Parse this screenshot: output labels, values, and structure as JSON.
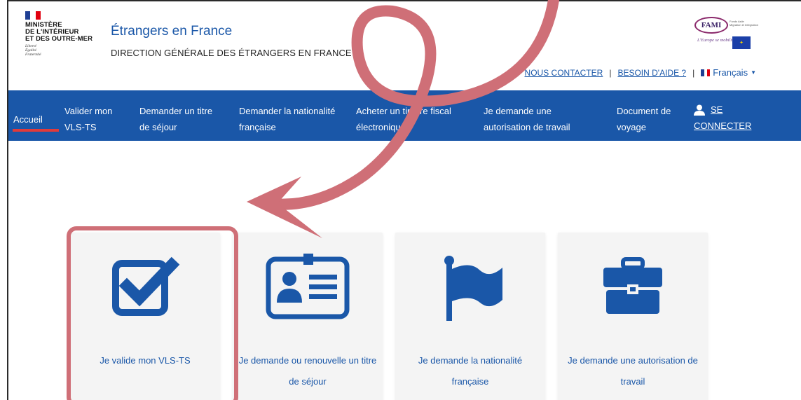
{
  "header": {
    "ministry": "MINISTÈRE\nDE L'INTÉRIEUR\nET DES OUTRE-MER",
    "motto": "Liberté\nÉgalité\nFraternité",
    "site_title": "Étrangers en France",
    "site_subtitle": "DIRECTION GÉNÉRALE DES ÉTRANGERS EN FRANCE",
    "fami": {
      "brand": "FAMI",
      "small_text": "Fonds Asile\nMigration et Intégration",
      "slogan": "L'Europe se mobilise"
    },
    "top_links": {
      "contact": "NOUS CONTACTER",
      "help": "BESOIN D'AIDE ?",
      "language": "Français",
      "separator": "|"
    }
  },
  "nav": {
    "items": [
      {
        "label": "Accueil",
        "active": true
      },
      {
        "label": "Valider mon\nVLS-TS"
      },
      {
        "label": "Demander un titre\nde séjour"
      },
      {
        "label": "Demander la nationalité\nfrançaise"
      },
      {
        "label": "Acheter un timbre fiscal\nélectronique"
      },
      {
        "label": "Je demande une\nautorisation de travail"
      },
      {
        "label": "Document de\nvoyage"
      }
    ],
    "login_line1": "SE",
    "login_line2": "CONNECTER"
  },
  "cards": [
    {
      "label": "Je valide mon VLS-TS",
      "icon": "checkbox-check-icon"
    },
    {
      "label": "Je demande ou renouvelle un titre\nde séjour",
      "icon": "id-card-icon"
    },
    {
      "label": "Je demande la nationalité\nfrançaise",
      "icon": "flag-icon"
    },
    {
      "label": "Je demande une autorisation de\ntravail",
      "icon": "briefcase-icon"
    }
  ],
  "colors": {
    "brand_blue": "#1a57a8",
    "active_red": "#e03b3b",
    "annotation_pink": "#cf6f77",
    "card_bg": "#f4f4f4"
  }
}
